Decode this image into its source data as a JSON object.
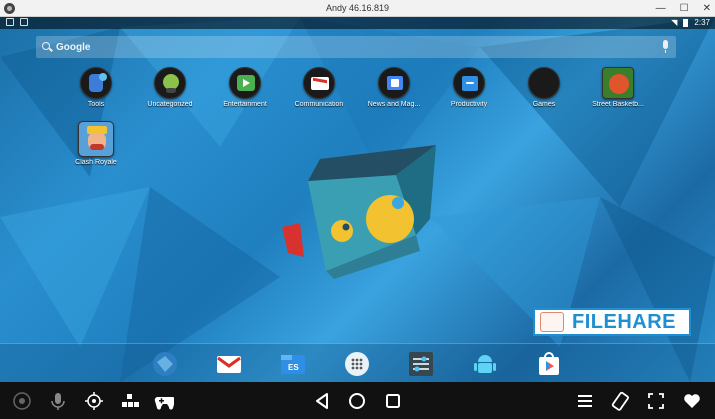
{
  "window": {
    "title": "Andy 46.16.819",
    "min_label": "—",
    "max_label": "☐",
    "close_label": "✕"
  },
  "statusbar": {
    "time": "2:37"
  },
  "search": {
    "placeholder": "Google"
  },
  "apps": [
    {
      "label": "Tools"
    },
    {
      "label": "Uncategorized"
    },
    {
      "label": "Entertainment"
    },
    {
      "label": "Communication"
    },
    {
      "label": "News and Mag..."
    },
    {
      "label": "Productivity"
    },
    {
      "label": "Games"
    },
    {
      "label": "Street Basketb..."
    },
    {
      "label": "Clash Royale"
    }
  ],
  "dock": [
    {
      "icon": "browser-icon"
    },
    {
      "icon": "gmail-icon"
    },
    {
      "icon": "file-explorer-icon"
    },
    {
      "icon": "app-drawer-icon"
    },
    {
      "icon": "settings-icon"
    },
    {
      "icon": "android-icon"
    },
    {
      "icon": "play-store-icon"
    }
  ],
  "watermark": {
    "text": "FILEHARE"
  },
  "colors": {
    "accent": "#1f8fd1",
    "wallpaper": "#2a8fcf"
  }
}
